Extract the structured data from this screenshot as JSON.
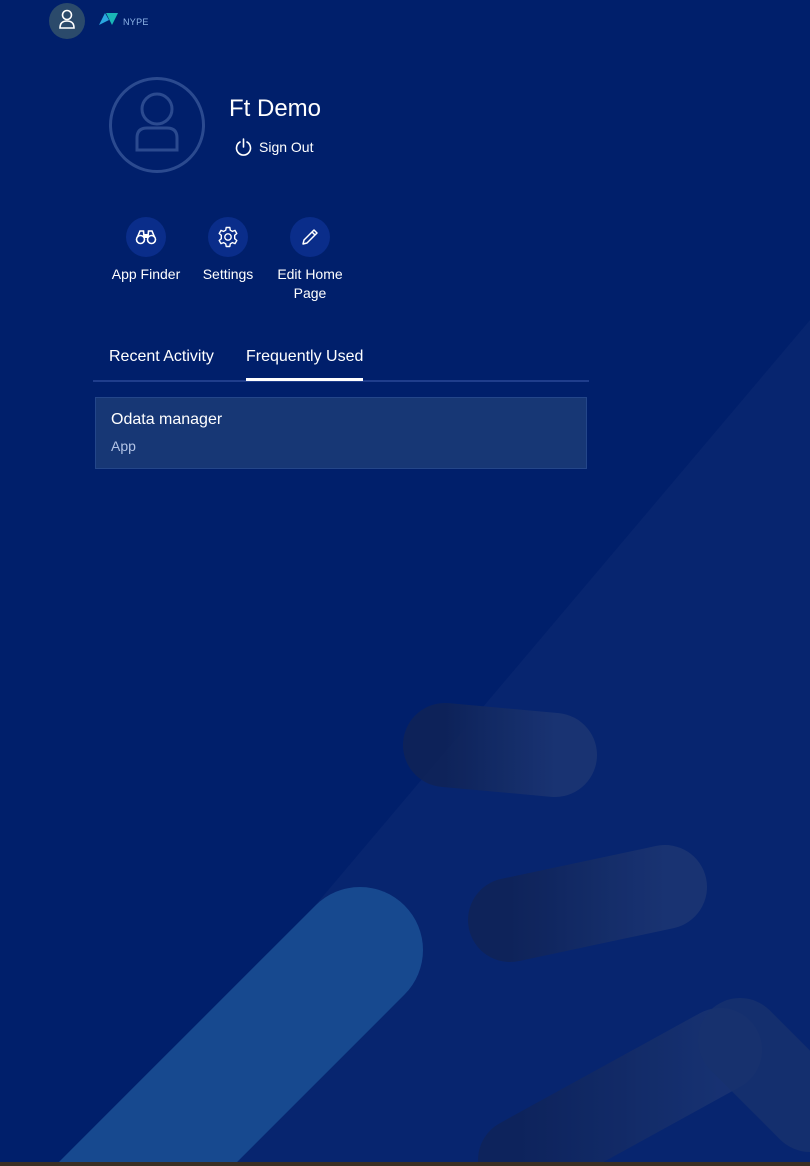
{
  "header": {
    "logo_text": "NYPE",
    "avatar_icon": "person-icon"
  },
  "user": {
    "name": "Ft Demo",
    "sign_out_label": "Sign Out"
  },
  "actions": [
    {
      "label": "App Finder",
      "icon": "binoculars-icon"
    },
    {
      "label": "Settings",
      "icon": "gear-icon"
    },
    {
      "label": "Edit Home Page",
      "icon": "pencil-icon"
    }
  ],
  "tabs": [
    {
      "label": "Recent Activity",
      "selected": false
    },
    {
      "label": "Frequently Used",
      "selected": true
    }
  ],
  "frequently_used": [
    {
      "title": "Odata manager",
      "type": "App"
    }
  ],
  "colors": {
    "background": "#001f6b",
    "item_background": "#173775",
    "accent": "#1d56a8"
  }
}
